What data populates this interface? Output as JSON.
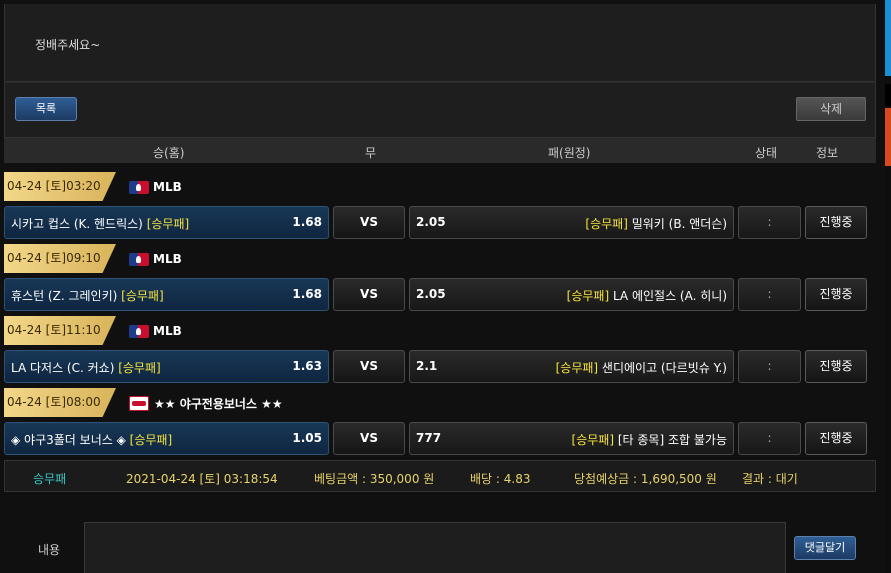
{
  "post": {
    "content": "정배주세요~"
  },
  "buttons": {
    "list": "목록",
    "delete": "삭제",
    "comment_submit": "댓글달기"
  },
  "table_header": {
    "home": "승(홈)",
    "draw": "무",
    "away": "패(원정)",
    "status": "상태",
    "info": "정보"
  },
  "vs_label": "VS",
  "games": [
    {
      "date": "04-24 [토]03:20",
      "league": "MLB",
      "league_icon": "mlb-logo-icon",
      "home": "시카고 컵스 (K. 헨드릭스)",
      "home_tag": "[승무패]",
      "home_odds": "1.68",
      "away_odds": "2.05",
      "away_tag": "[승무패]",
      "away": "밀워키 (B. 앤더슨)",
      "status": ":",
      "info": "진행중"
    },
    {
      "date": "04-24 [토]09:10",
      "league": "MLB",
      "league_icon": "mlb-logo-icon",
      "home": "휴스턴 (Z. 그레인키)",
      "home_tag": "[승무패]",
      "home_odds": "1.68",
      "away_odds": "2.05",
      "away_tag": "[승무패]",
      "away": "LA 에인절스 (A. 히니)",
      "status": ":",
      "info": "진행중"
    },
    {
      "date": "04-24 [토]11:10",
      "league": "MLB",
      "league_icon": "mlb-logo-icon",
      "home": "LA 다저스 (C. 커쇼)",
      "home_tag": "[승무패]",
      "home_odds": "1.63",
      "away_odds": "2.1",
      "away_tag": "[승무패]",
      "away": "샌디에이고 (다르빗슈 Y.)",
      "status": ":",
      "info": "진행중"
    },
    {
      "date": "04-24 [토]08:00",
      "league": "★★ 야구전용보너스 ★★",
      "league_icon": "baseball-bonus-icon",
      "home": "◈ 야구3폴더 보너스 ◈",
      "home_tag": "[승무패]",
      "home_odds": "1.05",
      "away_odds": "777",
      "away_tag": "[승무패]",
      "away": "[타 종목] 조합 불가능",
      "status": ":",
      "info": "진행중"
    }
  ],
  "summary": {
    "type": "승무패",
    "datetime": "2021-04-24 [토] 03:18:54",
    "bet_amount": "베팅금액 : 350,000 원",
    "odds": "배당 : 4.83",
    "expected": "당첨예상금 : 1,690,500 원",
    "result": "결과 : 대기"
  },
  "comment": {
    "label": "내용"
  },
  "colors": {
    "highlight": "#f6e23c",
    "summary_teal": "#38c6c6",
    "summary_yellow": "#e8d36a",
    "button_blue": "#2f5e95"
  }
}
